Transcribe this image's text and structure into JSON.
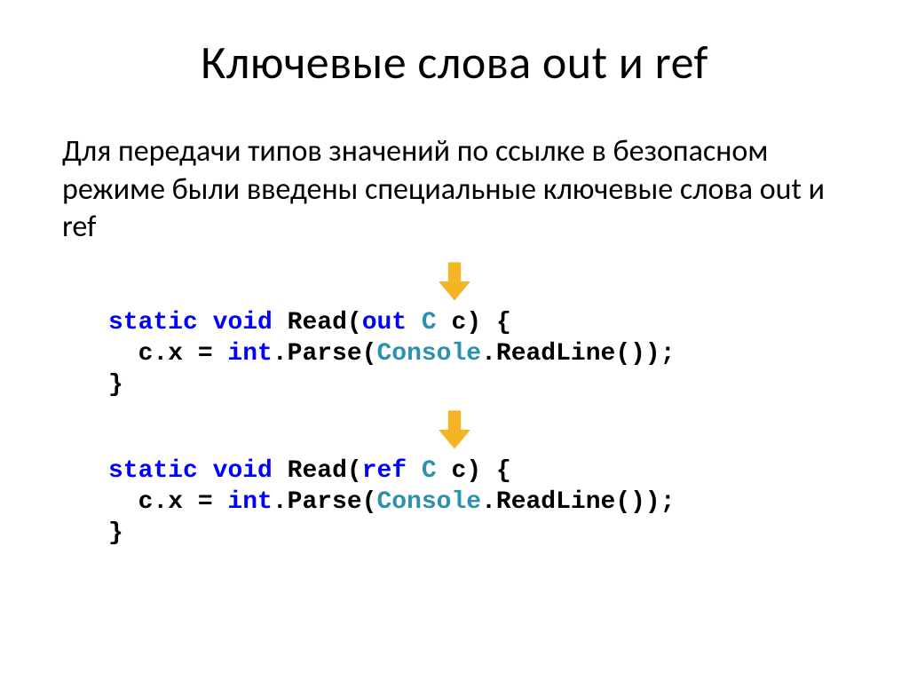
{
  "title": "Ключевые слова out и ref",
  "description": "Для передачи типов значений по ссылке в безопасном режиме были введены специальные ключевые слова out и ref",
  "code1": {
    "kw_static": "static",
    "kw_void": "void",
    "fn": " Read(",
    "kw_out": "out",
    "sp": " ",
    "type_C": "C",
    "tail_sig": " c) {",
    "line2a": "  c.x = ",
    "kw_int": "int",
    "line2b": ".Parse(",
    "type_Console": "Console",
    "line2c": ".ReadLine());",
    "line3": "}"
  },
  "code2": {
    "kw_static": "static",
    "kw_void": "void",
    "fn": " Read(",
    "kw_ref": "ref",
    "sp": " ",
    "type_C": "C",
    "tail_sig": " c) {",
    "line2a": "  c.x = ",
    "kw_int": "int",
    "line2b": ".Parse(",
    "type_Console": "Console",
    "line2c": ".ReadLine());",
    "line3": "}"
  },
  "colors": {
    "arrow": "#f5b425"
  }
}
